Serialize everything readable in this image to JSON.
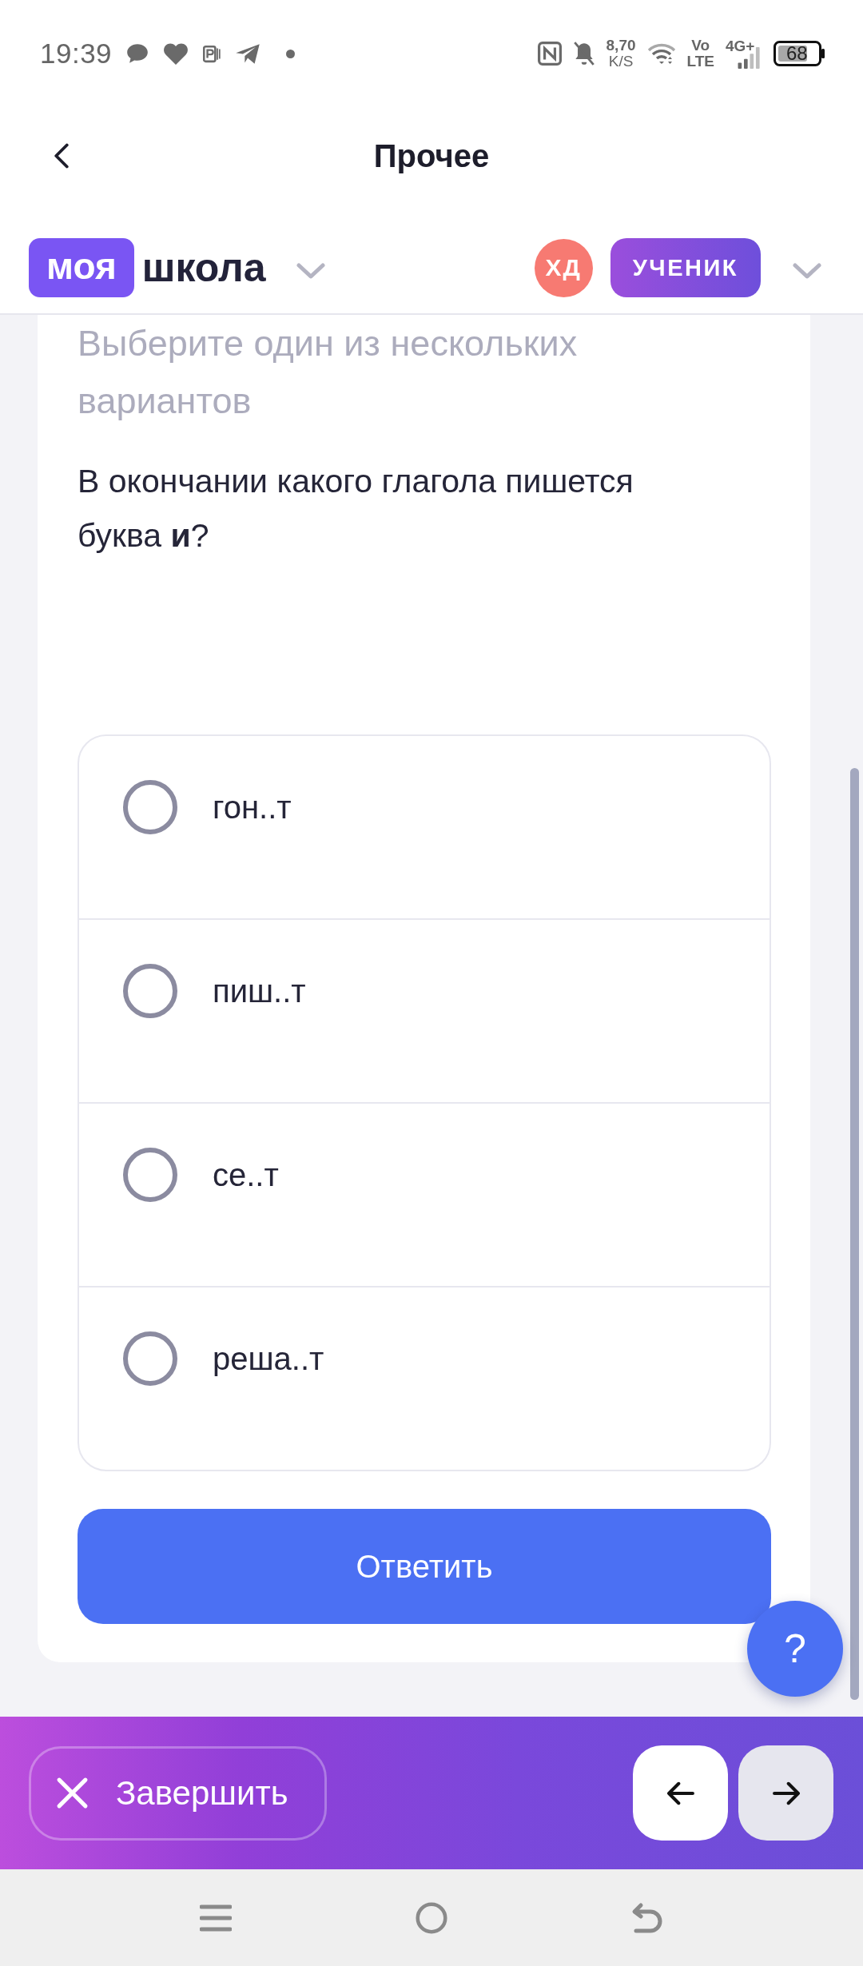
{
  "status_bar": {
    "time": "19:39",
    "net_speed": "8,70",
    "net_speed_unit": "K/S",
    "volte": "Vo",
    "volte_sub": "LTE",
    "network_type": "4G+",
    "battery": "68"
  },
  "header": {
    "title": "Прочее"
  },
  "brand_bar": {
    "logo_highlight": "моя",
    "logo_text": "школа",
    "avatar_initials": "ХД",
    "role": "УЧЕНИК"
  },
  "task": {
    "instruction": "Выберите один из нескольких вариантов",
    "question": "В окончании какого глагола пишется буква **и**?",
    "options": [
      {
        "label": "гон..т",
        "selected": false
      },
      {
        "label": "пиш..т",
        "selected": false
      },
      {
        "label": "се..т",
        "selected": false
      },
      {
        "label": "реша..т",
        "selected": false
      }
    ],
    "submit_button": "Ответить"
  },
  "help_button": "?",
  "bottom_bar": {
    "finish_button": "Завершить",
    "nav_buttons": [
      {
        "kind": "back"
      },
      {
        "kind": "forward"
      }
    ]
  }
}
